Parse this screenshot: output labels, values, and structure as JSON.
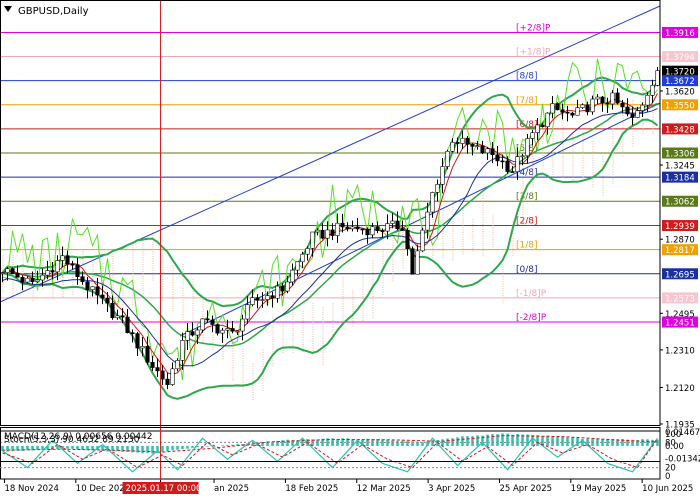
{
  "chart_data": {
    "type": "candlestick",
    "title": "GBPUSD,Daily",
    "price_axis": {
      "ylim": [
        1.193,
        1.407
      ],
      "ticks": [
        {
          "label": "1.3916",
          "value": 1.3916,
          "highlight": true,
          "bg": "#e000e0",
          "fg": "#ffffff"
        },
        {
          "label": "1.3794",
          "value": 1.3794,
          "highlight": true,
          "bg": "#f7c6ce",
          "fg": "#ffffff"
        },
        {
          "label": "1.3720",
          "value": 1.372,
          "highlight": true,
          "bg": "#000000",
          "fg": "#ffffff"
        },
        {
          "label": "1.3672",
          "value": 1.3672,
          "highlight": true,
          "bg": "#1f3fd1",
          "fg": "#ffffff"
        },
        {
          "label": "1.3620",
          "value": 1.362,
          "highlight": false
        },
        {
          "label": "1.3550",
          "value": 1.355,
          "highlight": true,
          "bg": "#f0a000",
          "fg": "#ffffff"
        },
        {
          "label": "1.3428",
          "value": 1.3428,
          "highlight": true,
          "bg": "#d11a1a",
          "fg": "#ffffff"
        },
        {
          "label": "1.3306",
          "value": 1.3306,
          "highlight": true,
          "bg": "#5a7a1a",
          "fg": "#ffffff"
        },
        {
          "label": "1.3245",
          "value": 1.3245,
          "highlight": false
        },
        {
          "label": "1.3184",
          "value": 1.3184,
          "highlight": true,
          "bg": "#1a2fa0",
          "fg": "#ffffff"
        },
        {
          "label": "1.3062",
          "value": 1.3062,
          "highlight": true,
          "bg": "#5a7a1a",
          "fg": "#ffffff"
        },
        {
          "label": "1.2939",
          "value": 1.2939,
          "highlight": true,
          "bg": "#d11a1a",
          "fg": "#ffffff"
        },
        {
          "label": "1.2870",
          "value": 1.287,
          "highlight": false
        },
        {
          "label": "1.2817",
          "value": 1.2817,
          "highlight": true,
          "bg": "#f0a000",
          "fg": "#ffffff"
        },
        {
          "label": "1.2695",
          "value": 1.2695,
          "highlight": true,
          "bg": "#1a2fa0",
          "fg": "#ffffff"
        },
        {
          "label": "1.2573",
          "value": 1.2573,
          "highlight": true,
          "bg": "#f7c6ce",
          "fg": "#ffffff"
        },
        {
          "label": "1.2495",
          "value": 1.2495,
          "highlight": false
        },
        {
          "label": "1.2451",
          "value": 1.2451,
          "highlight": true,
          "bg": "#e000e0",
          "fg": "#ffffff"
        },
        {
          "label": "1.2310",
          "value": 1.231,
          "highlight": false
        },
        {
          "label": "1.2120",
          "value": 1.212,
          "highlight": false
        },
        {
          "label": "1.1935",
          "value": 1.1935,
          "highlight": false
        }
      ]
    },
    "murrey_levels": [
      {
        "label": "[+2/8]P",
        "value": 1.3916,
        "color": "#e000e0"
      },
      {
        "label": "[+1/8]P",
        "value": 1.3794,
        "color": "#f2a6b4"
      },
      {
        "label": "[8/8]",
        "value": 1.3672,
        "color": "#1f3fd1"
      },
      {
        "label": "[7/8]",
        "value": 1.355,
        "color": "#e8a000"
      },
      {
        "label": "[6/8]",
        "value": 1.3428,
        "color": "#d11a1a"
      },
      {
        "label": "[5/8]",
        "value": 1.3306,
        "color": "#5a7a1a"
      },
      {
        "label": "[4/8]",
        "value": 1.3184,
        "color": "#1a2fa0"
      },
      {
        "label": "[3/8]",
        "value": 1.3062,
        "color": "#5a7a1a"
      },
      {
        "label": "[2/8]",
        "value": 1.2939,
        "color": "#d11a1a"
      },
      {
        "label": "[1/8]",
        "value": 1.2817,
        "color": "#e8a000"
      },
      {
        "label": "[0/8]",
        "value": 1.2695,
        "color": "#1a2fa0"
      },
      {
        "label": "[-1/8]P",
        "value": 1.2573,
        "color": "#f2a6b4"
      },
      {
        "label": "[-2/8]P",
        "value": 1.2451,
        "color": "#e000e0"
      }
    ],
    "close_points": [
      {
        "t": 0,
        "v": 1.272
      },
      {
        "t": 6,
        "v": 1.264
      },
      {
        "t": 12,
        "v": 1.278
      },
      {
        "t": 18,
        "v": 1.26
      },
      {
        "t": 24,
        "v": 1.245
      },
      {
        "t": 30,
        "v": 1.223
      },
      {
        "t": 33,
        "v": 1.214
      },
      {
        "t": 36,
        "v": 1.235
      },
      {
        "t": 40,
        "v": 1.245
      },
      {
        "t": 46,
        "v": 1.239
      },
      {
        "t": 50,
        "v": 1.255
      },
      {
        "t": 56,
        "v": 1.262
      },
      {
        "t": 62,
        "v": 1.288
      },
      {
        "t": 68,
        "v": 1.293
      },
      {
        "t": 74,
        "v": 1.292
      },
      {
        "t": 80,
        "v": 1.294
      },
      {
        "t": 82,
        "v": 1.27
      },
      {
        "t": 86,
        "v": 1.31
      },
      {
        "t": 90,
        "v": 1.338
      },
      {
        "t": 94,
        "v": 1.333
      },
      {
        "t": 98,
        "v": 1.33
      },
      {
        "t": 102,
        "v": 1.322
      },
      {
        "t": 106,
        "v": 1.34
      },
      {
        "t": 110,
        "v": 1.353
      },
      {
        "t": 114,
        "v": 1.349
      },
      {
        "t": 118,
        "v": 1.356
      },
      {
        "t": 122,
        "v": 1.358
      },
      {
        "t": 126,
        "v": 1.347
      },
      {
        "t": 128,
        "v": 1.356
      },
      {
        "t": 131,
        "v": 1.373
      }
    ],
    "x_axis": {
      "n_bars": 132,
      "labels": [
        {
          "label": "18 Nov 2024",
          "bar": 1
        },
        {
          "label": "10 Dec 2024",
          "bar": 17
        },
        {
          "label": "2025.01.17 00:00",
          "bar": 36,
          "highlight": true
        },
        {
          "label": "an 2025",
          "bar": 48
        },
        {
          "label": "18 Feb 2025",
          "bar": 64
        },
        {
          "label": "12 Mar 2025",
          "bar": 80
        },
        {
          "label": "3 Apr 2025",
          "bar": 96
        },
        {
          "label": "25 Apr 2025",
          "bar": 112
        },
        {
          "label": "19 May 2025",
          "bar": 128
        },
        {
          "label": "10 Jun 2025",
          "bar": 144
        }
      ]
    },
    "cursor": {
      "bar": 36
    },
    "macd": {
      "label": "MACD(12,26,9) 0.00656 0.00442",
      "ylim": [
        -0.016,
        0.017
      ],
      "ticks": [
        {
          "label": "0.01467",
          "value": 0.01467
        },
        {
          "label": "0.00",
          "value": 0
        },
        {
          "label": "-0.01342",
          "value": -0.01342
        }
      ],
      "hist_points": [
        {
          "t": 0,
          "v": -0.006
        },
        {
          "t": 12,
          "v": -0.003
        },
        {
          "t": 20,
          "v": -0.005
        },
        {
          "t": 30,
          "v": -0.008
        },
        {
          "t": 38,
          "v": -0.002
        },
        {
          "t": 46,
          "v": 0.001
        },
        {
          "t": 56,
          "v": 0.006
        },
        {
          "t": 66,
          "v": 0.008
        },
        {
          "t": 76,
          "v": 0.007
        },
        {
          "t": 84,
          "v": 0.004
        },
        {
          "t": 92,
          "v": 0.01
        },
        {
          "t": 100,
          "v": 0.013
        },
        {
          "t": 108,
          "v": 0.011
        },
        {
          "t": 116,
          "v": 0.008
        },
        {
          "t": 124,
          "v": 0.007
        },
        {
          "t": 131,
          "v": 0.0066
        }
      ],
      "signal_points": [
        {
          "t": 0,
          "v": -0.0045
        },
        {
          "t": 12,
          "v": -0.0035
        },
        {
          "t": 22,
          "v": -0.0045
        },
        {
          "t": 32,
          "v": -0.0065
        },
        {
          "t": 42,
          "v": -0.0025
        },
        {
          "t": 54,
          "v": 0.0045
        },
        {
          "t": 66,
          "v": 0.007
        },
        {
          "t": 78,
          "v": 0.0065
        },
        {
          "t": 88,
          "v": 0.005
        },
        {
          "t": 100,
          "v": 0.011
        },
        {
          "t": 112,
          "v": 0.01
        },
        {
          "t": 124,
          "v": 0.006
        },
        {
          "t": 131,
          "v": 0.0044
        }
      ]
    },
    "stoch": {
      "label": "Stoch(5,3,3) 90.4632 89.2130",
      "ylim": [
        0,
        100
      ],
      "ticks": [
        {
          "label": "100",
          "value": 100
        },
        {
          "label": "80",
          "value": 80
        },
        {
          "label": "20",
          "value": 20
        },
        {
          "label": "0",
          "value": 0
        }
      ],
      "k_points": [
        {
          "t": 0,
          "v": 60
        },
        {
          "t": 5,
          "v": 20
        },
        {
          "t": 10,
          "v": 85
        },
        {
          "t": 15,
          "v": 30
        },
        {
          "t": 20,
          "v": 75
        },
        {
          "t": 26,
          "v": 10
        },
        {
          "t": 31,
          "v": 60
        },
        {
          "t": 35,
          "v": 15
        },
        {
          "t": 40,
          "v": 90
        },
        {
          "t": 45,
          "v": 40
        },
        {
          "t": 50,
          "v": 85
        },
        {
          "t": 55,
          "v": 35
        },
        {
          "t": 60,
          "v": 90
        },
        {
          "t": 66,
          "v": 20
        },
        {
          "t": 71,
          "v": 85
        },
        {
          "t": 76,
          "v": 30
        },
        {
          "t": 81,
          "v": 10
        },
        {
          "t": 86,
          "v": 90
        },
        {
          "t": 91,
          "v": 25
        },
        {
          "t": 96,
          "v": 80
        },
        {
          "t": 101,
          "v": 15
        },
        {
          "t": 106,
          "v": 90
        },
        {
          "t": 111,
          "v": 45
        },
        {
          "t": 116,
          "v": 85
        },
        {
          "t": 121,
          "v": 30
        },
        {
          "t": 126,
          "v": 10
        },
        {
          "t": 131,
          "v": 90
        }
      ],
      "d_points": [
        {
          "t": 0,
          "v": 55
        },
        {
          "t": 6,
          "v": 30
        },
        {
          "t": 11,
          "v": 75
        },
        {
          "t": 16,
          "v": 40
        },
        {
          "t": 21,
          "v": 65
        },
        {
          "t": 27,
          "v": 20
        },
        {
          "t": 32,
          "v": 50
        },
        {
          "t": 36,
          "v": 25
        },
        {
          "t": 41,
          "v": 80
        },
        {
          "t": 46,
          "v": 50
        },
        {
          "t": 51,
          "v": 75
        },
        {
          "t": 56,
          "v": 45
        },
        {
          "t": 61,
          "v": 80
        },
        {
          "t": 67,
          "v": 30
        },
        {
          "t": 72,
          "v": 75
        },
        {
          "t": 77,
          "v": 40
        },
        {
          "t": 82,
          "v": 20
        },
        {
          "t": 87,
          "v": 80
        },
        {
          "t": 92,
          "v": 35
        },
        {
          "t": 97,
          "v": 70
        },
        {
          "t": 102,
          "v": 25
        },
        {
          "t": 107,
          "v": 80
        },
        {
          "t": 112,
          "v": 55
        },
        {
          "t": 117,
          "v": 75
        },
        {
          "t": 122,
          "v": 40
        },
        {
          "t": 127,
          "v": 20
        },
        {
          "t": 131,
          "v": 89
        }
      ]
    },
    "colors": {
      "bull_candle": "#000000",
      "bear_candle": "#000000",
      "bollinger": "#2ea84a",
      "envelope_light": "#55e022",
      "ma_red": "#d11a1a",
      "ma_blue": "#1a2fa0",
      "channel": "#1f3fd1",
      "ichimoku_cloud": "#e9b89a",
      "macd_hist": "#29c3b0",
      "macd_signal": "#d11a1a",
      "stoch_k": "#29c3b0",
      "stoch_d": "#d11a1a",
      "cursor": "#d11a1a"
    }
  }
}
